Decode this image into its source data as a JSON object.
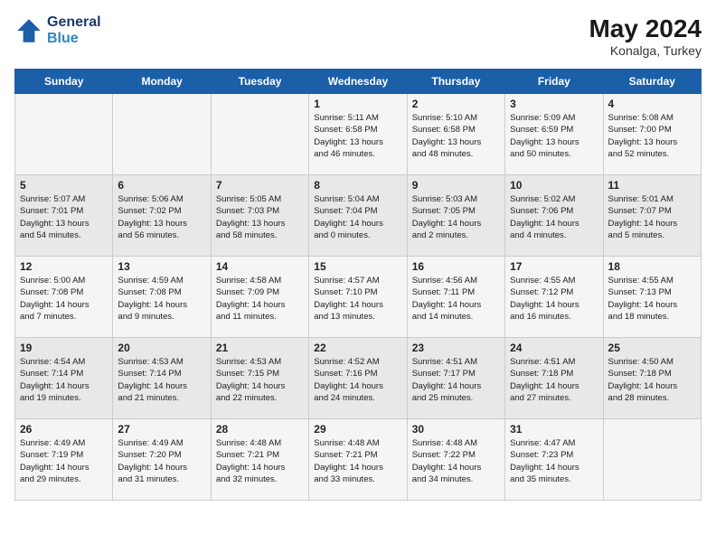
{
  "header": {
    "logo_line1": "General",
    "logo_line2": "Blue",
    "month_year": "May 2024",
    "location": "Konalga, Turkey"
  },
  "weekdays": [
    "Sunday",
    "Monday",
    "Tuesday",
    "Wednesday",
    "Thursday",
    "Friday",
    "Saturday"
  ],
  "weeks": [
    [
      {
        "day": "",
        "content": ""
      },
      {
        "day": "",
        "content": ""
      },
      {
        "day": "",
        "content": ""
      },
      {
        "day": "1",
        "content": "Sunrise: 5:11 AM\nSunset: 6:58 PM\nDaylight: 13 hours\nand 46 minutes."
      },
      {
        "day": "2",
        "content": "Sunrise: 5:10 AM\nSunset: 6:58 PM\nDaylight: 13 hours\nand 48 minutes."
      },
      {
        "day": "3",
        "content": "Sunrise: 5:09 AM\nSunset: 6:59 PM\nDaylight: 13 hours\nand 50 minutes."
      },
      {
        "day": "4",
        "content": "Sunrise: 5:08 AM\nSunset: 7:00 PM\nDaylight: 13 hours\nand 52 minutes."
      }
    ],
    [
      {
        "day": "5",
        "content": "Sunrise: 5:07 AM\nSunset: 7:01 PM\nDaylight: 13 hours\nand 54 minutes."
      },
      {
        "day": "6",
        "content": "Sunrise: 5:06 AM\nSunset: 7:02 PM\nDaylight: 13 hours\nand 56 minutes."
      },
      {
        "day": "7",
        "content": "Sunrise: 5:05 AM\nSunset: 7:03 PM\nDaylight: 13 hours\nand 58 minutes."
      },
      {
        "day": "8",
        "content": "Sunrise: 5:04 AM\nSunset: 7:04 PM\nDaylight: 14 hours\nand 0 minutes."
      },
      {
        "day": "9",
        "content": "Sunrise: 5:03 AM\nSunset: 7:05 PM\nDaylight: 14 hours\nand 2 minutes."
      },
      {
        "day": "10",
        "content": "Sunrise: 5:02 AM\nSunset: 7:06 PM\nDaylight: 14 hours\nand 4 minutes."
      },
      {
        "day": "11",
        "content": "Sunrise: 5:01 AM\nSunset: 7:07 PM\nDaylight: 14 hours\nand 5 minutes."
      }
    ],
    [
      {
        "day": "12",
        "content": "Sunrise: 5:00 AM\nSunset: 7:08 PM\nDaylight: 14 hours\nand 7 minutes."
      },
      {
        "day": "13",
        "content": "Sunrise: 4:59 AM\nSunset: 7:08 PM\nDaylight: 14 hours\nand 9 minutes."
      },
      {
        "day": "14",
        "content": "Sunrise: 4:58 AM\nSunset: 7:09 PM\nDaylight: 14 hours\nand 11 minutes."
      },
      {
        "day": "15",
        "content": "Sunrise: 4:57 AM\nSunset: 7:10 PM\nDaylight: 14 hours\nand 13 minutes."
      },
      {
        "day": "16",
        "content": "Sunrise: 4:56 AM\nSunset: 7:11 PM\nDaylight: 14 hours\nand 14 minutes."
      },
      {
        "day": "17",
        "content": "Sunrise: 4:55 AM\nSunset: 7:12 PM\nDaylight: 14 hours\nand 16 minutes."
      },
      {
        "day": "18",
        "content": "Sunrise: 4:55 AM\nSunset: 7:13 PM\nDaylight: 14 hours\nand 18 minutes."
      }
    ],
    [
      {
        "day": "19",
        "content": "Sunrise: 4:54 AM\nSunset: 7:14 PM\nDaylight: 14 hours\nand 19 minutes."
      },
      {
        "day": "20",
        "content": "Sunrise: 4:53 AM\nSunset: 7:14 PM\nDaylight: 14 hours\nand 21 minutes."
      },
      {
        "day": "21",
        "content": "Sunrise: 4:53 AM\nSunset: 7:15 PM\nDaylight: 14 hours\nand 22 minutes."
      },
      {
        "day": "22",
        "content": "Sunrise: 4:52 AM\nSunset: 7:16 PM\nDaylight: 14 hours\nand 24 minutes."
      },
      {
        "day": "23",
        "content": "Sunrise: 4:51 AM\nSunset: 7:17 PM\nDaylight: 14 hours\nand 25 minutes."
      },
      {
        "day": "24",
        "content": "Sunrise: 4:51 AM\nSunset: 7:18 PM\nDaylight: 14 hours\nand 27 minutes."
      },
      {
        "day": "25",
        "content": "Sunrise: 4:50 AM\nSunset: 7:18 PM\nDaylight: 14 hours\nand 28 minutes."
      }
    ],
    [
      {
        "day": "26",
        "content": "Sunrise: 4:49 AM\nSunset: 7:19 PM\nDaylight: 14 hours\nand 29 minutes."
      },
      {
        "day": "27",
        "content": "Sunrise: 4:49 AM\nSunset: 7:20 PM\nDaylight: 14 hours\nand 31 minutes."
      },
      {
        "day": "28",
        "content": "Sunrise: 4:48 AM\nSunset: 7:21 PM\nDaylight: 14 hours\nand 32 minutes."
      },
      {
        "day": "29",
        "content": "Sunrise: 4:48 AM\nSunset: 7:21 PM\nDaylight: 14 hours\nand 33 minutes."
      },
      {
        "day": "30",
        "content": "Sunrise: 4:48 AM\nSunset: 7:22 PM\nDaylight: 14 hours\nand 34 minutes."
      },
      {
        "day": "31",
        "content": "Sunrise: 4:47 AM\nSunset: 7:23 PM\nDaylight: 14 hours\nand 35 minutes."
      },
      {
        "day": "",
        "content": ""
      }
    ]
  ]
}
